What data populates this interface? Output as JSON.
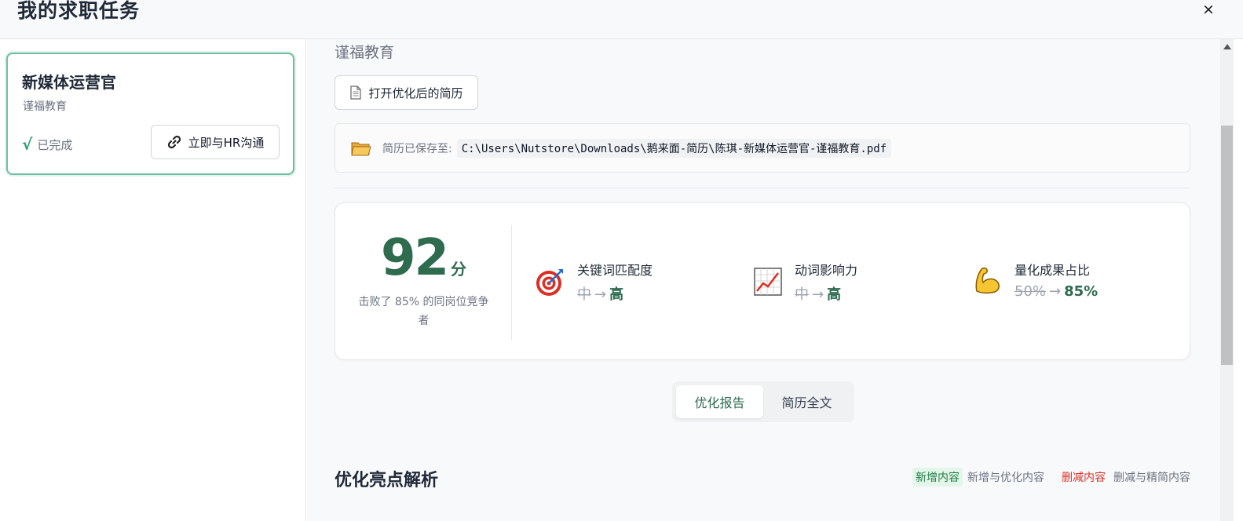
{
  "header": {
    "title": "我的求职任务",
    "close_label": "×"
  },
  "task": {
    "title": "新媒体运营官",
    "company": "谨福教育",
    "status_icon": "√",
    "status": "已完成",
    "hr_button": "立即与HR沟通"
  },
  "main": {
    "company": "谨福教育",
    "open_button": "打开优化后的简历",
    "saved_label": "简历已保存至:",
    "saved_path": "C:\\Users\\Nutstore\\Downloads\\鹅来面-简历\\陈琪-新媒体运营官-谨福教育.pdf"
  },
  "score": {
    "value": "92",
    "unit": "分",
    "subtitle": "击败了 85% 的同岗位竞争者"
  },
  "metrics": [
    {
      "label": "关键词匹配度",
      "old": "中",
      "arrow": "→",
      "new": "高",
      "icon": "target-icon"
    },
    {
      "label": "动词影响力",
      "old": "中",
      "arrow": "→",
      "new": "高",
      "icon": "chart-up-icon"
    },
    {
      "label": "量化成果占比",
      "old": "50%",
      "arrow": "→",
      "new": "85%",
      "icon": "muscle-icon"
    }
  ],
  "tabs": [
    {
      "label": "优化报告",
      "active": true
    },
    {
      "label": "简历全文",
      "active": false
    }
  ],
  "section": {
    "title": "优化亮点解析",
    "legend_add_tag": "新增内容",
    "legend_add_text": "新增与优化内容",
    "legend_del_tag": "删减内容",
    "legend_del_text": "删减与精简内容"
  },
  "colors": {
    "accent": "#2e6b4f",
    "card_border": "#6fbfa0",
    "delete": "#d93025"
  }
}
